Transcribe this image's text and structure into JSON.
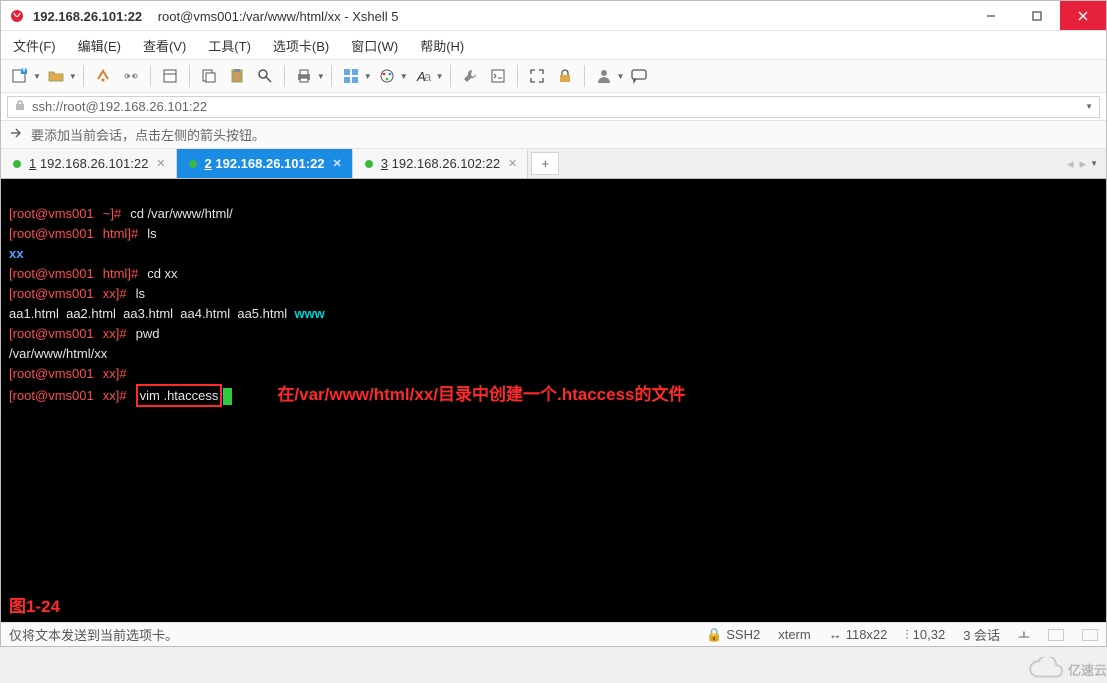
{
  "title": "192.168.26.101:22",
  "subtitle": "root@vms001:/var/www/html/xx - Xshell 5",
  "menubar": [
    "文件(F)",
    "编辑(E)",
    "查看(V)",
    "工具(T)",
    "选项卡(B)",
    "窗口(W)",
    "帮助(H)"
  ],
  "address": "ssh://root@192.168.26.101:22",
  "infobar": "要添加当前会话，点击左侧的箭头按钮。",
  "tabs": [
    {
      "num": "1",
      "label": "192.168.26.101:22",
      "active": false
    },
    {
      "num": "2",
      "label": "192.168.26.101:22",
      "active": true
    },
    {
      "num": "3",
      "label": "192.168.26.102:22",
      "active": false
    }
  ],
  "tab_add": "+",
  "term": {
    "p1_user": "root@vms001",
    "p1_path": "~",
    "p1_cmd": "cd /var/www/html/",
    "p2_user": "root@vms001",
    "p2_path": "html",
    "p2_cmd": "ls",
    "ls1": "xx",
    "p3_user": "root@vms001",
    "p3_path": "html",
    "p3_cmd": "cd xx",
    "p4_user": "root@vms001",
    "p4_path": "xx",
    "p4_cmd": "ls",
    "files": "aa1.html  aa2.html  aa3.html  aa4.html  aa5.html  ",
    "files_dir": "www",
    "p5_user": "root@vms001",
    "p5_path": "xx",
    "p5_cmd": "pwd",
    "pwd": "/var/www/html/xx",
    "p6_user": "root@vms001",
    "p6_path": "xx",
    "p6_cmd": "",
    "p7_user": "root@vms001",
    "p7_path": "xx",
    "p7_cmd": "vim .htaccess",
    "annotation": "在/var/www/html/xx/目录中创建一个.htaccess的文件",
    "figlabel": "图1-24"
  },
  "status": {
    "left": "仅将文本发送到当前选项卡。",
    "ssh": "SSH2",
    "term": "xterm",
    "size": "118x22",
    "pos": "10,32",
    "sess": "3 会话",
    "extra": "ㅗ"
  },
  "watermark": "亿速云",
  "colors": {
    "accent": "#1b8ce4",
    "close": "#e6213c",
    "red": "#ff2a2a",
    "promptred": "#ff4d4d",
    "blue": "#5a9bff",
    "cyan": "#00d2d2",
    "green": "#3cb83c"
  }
}
